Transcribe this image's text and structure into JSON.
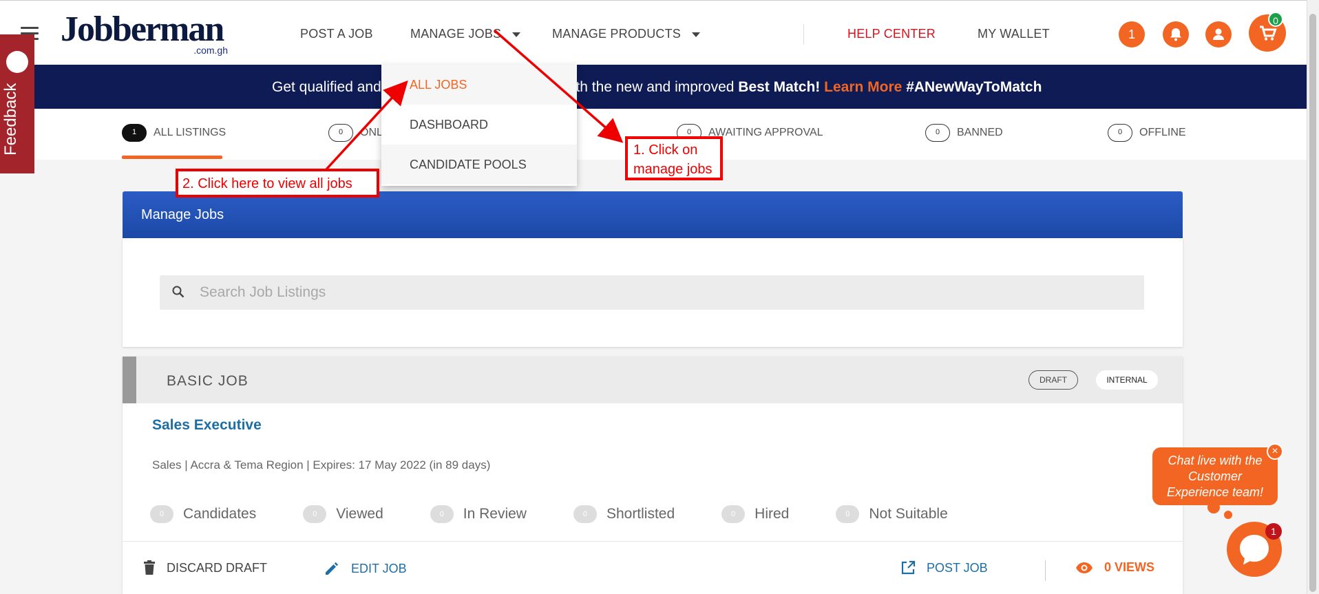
{
  "header": {
    "logo": {
      "word": "Jobberman",
      "sub": ".com.gh"
    },
    "nav": {
      "post_job": "POST A JOB",
      "manage_jobs": "MANAGE JOBS",
      "manage_products": "MANAGE PRODUCTS",
      "help_center": "HELP CENTER",
      "my_wallet": "MY WALLET"
    },
    "notification_count": "1",
    "cart_count": "0"
  },
  "dropdown": {
    "items": [
      "ALL JOBS",
      "DASHBOARD",
      "CANDIDATE POOLS"
    ]
  },
  "banner": {
    "part1": "Get qualified and",
    "part2": "ith the new and improved ",
    "best_match": "Best Match!",
    "learn_more": "Learn More",
    "hashtag": "#ANewWayToMatch"
  },
  "feedback": {
    "label": "Feedback"
  },
  "tabs": [
    {
      "count": "1",
      "label": "ALL LISTINGS"
    },
    {
      "count": "0",
      "label": "ONL"
    },
    {
      "count": "0",
      "label": "AWAITING APPROVAL"
    },
    {
      "count": "0",
      "label": "BANNED"
    },
    {
      "count": "0",
      "label": "OFFLINE"
    }
  ],
  "manage_jobs": {
    "title": "Manage Jobs",
    "search_placeholder": "Search Job Listings"
  },
  "job": {
    "type": "BASIC JOB",
    "badges": {
      "draft": "DRAFT",
      "internal": "INTERNAL"
    },
    "title": "Sales Executive",
    "meta": "Sales | Accra & Tema Region | Expires: 17 May 2022 (in 89 days)",
    "stats": [
      {
        "count": "0",
        "label": "Candidates"
      },
      {
        "count": "0",
        "label": "Viewed"
      },
      {
        "count": "0",
        "label": "In Review"
      },
      {
        "count": "0",
        "label": "Shortlisted"
      },
      {
        "count": "0",
        "label": "Hired"
      },
      {
        "count": "0",
        "label": "Not Suitable"
      }
    ],
    "actions": {
      "discard": "DISCARD DRAFT",
      "edit": "EDIT JOB",
      "post": "POST JOB",
      "views": "0 VIEWS"
    }
  },
  "annotations": {
    "step1_line1": "1. Click on",
    "step1_line2": "manage jobs",
    "step2": "2. Click here to view all jobs"
  },
  "chat": {
    "line1": "Chat live with the",
    "line2": "Customer",
    "line3": "Experience team!",
    "close": "×",
    "badge": "1"
  },
  "colors": {
    "accent_orange": "#f26522",
    "banner_navy": "#0e1b55",
    "panel_blue": "#2b5cc4",
    "link_blue": "#1c6ea4",
    "help_red": "#d5131e",
    "annotation_red": "#e00000",
    "feedback_red": "#a3242a"
  }
}
